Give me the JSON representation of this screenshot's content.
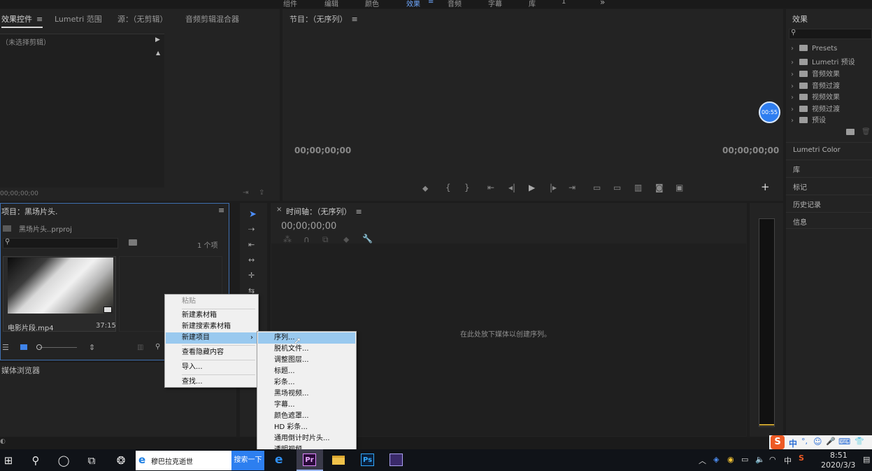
{
  "workspace_tabs": [
    "组件",
    "编辑",
    "颜色",
    "效果",
    "音频",
    "字幕",
    "库",
    "1"
  ],
  "workspace_active": "效果",
  "workspace_more": "»",
  "source_panel": {
    "tabs": [
      "效果控件",
      "Lumetri 范围",
      "源：（无剪辑）",
      "音频剪辑混合器"
    ],
    "no_clip": "（未选择剪辑）",
    "timecode": "00;00;00;00"
  },
  "program_panel": {
    "title": "节目：（无序列）",
    "timecode_left": "00;00;00;00",
    "timecode_right": "00;00;00;00",
    "badge": "00:55"
  },
  "project_panel": {
    "title": "项目：黑场片头.",
    "file": "黑场片头..prproj",
    "item_count": "1 个项",
    "clip_name": "电影片段.mp4",
    "clip_duration": "37:15"
  },
  "media_browser": "媒体浏览器",
  "timeline_panel": {
    "title": "时间轴：（无序列）",
    "timecode": "00;00;00;00",
    "drop_hint": "在此处放下媒体以创建序列。"
  },
  "effects_panel": {
    "title": "效果",
    "tree": [
      "Presets",
      "Lumetri 预设",
      "音频效果",
      "音频过渡",
      "视频效果",
      "视频过渡",
      "预设"
    ],
    "sections": [
      "Lumetri Color",
      "库",
      "标记",
      "历史记录",
      "信息"
    ]
  },
  "context_menu": {
    "items": [
      "粘贴",
      "新建素材箱",
      "新建搜索素材箱",
      "新建项目",
      "查看隐藏内容",
      "导入...",
      "查找..."
    ],
    "submenu_arrow": "›"
  },
  "submenu": {
    "items": [
      "序列...",
      "脱机文件...",
      "调整图层...",
      "标题...",
      "彩条...",
      "黑场视频...",
      "字幕...",
      "颜色遮罩...",
      "HD 彩条...",
      "通用倒计时片头...",
      "透明视频..."
    ]
  },
  "taskbar": {
    "search_text": "穆巴拉克逝世",
    "search_button": "搜索一下",
    "apps": [
      "e",
      "Pr",
      "Ps"
    ],
    "ime": "中",
    "time": "8:51",
    "date": "2020/3/3"
  },
  "ime_toolbar": [
    "S",
    "中",
    "°,",
    "☺",
    "🎤",
    "⌨",
    "👕"
  ]
}
